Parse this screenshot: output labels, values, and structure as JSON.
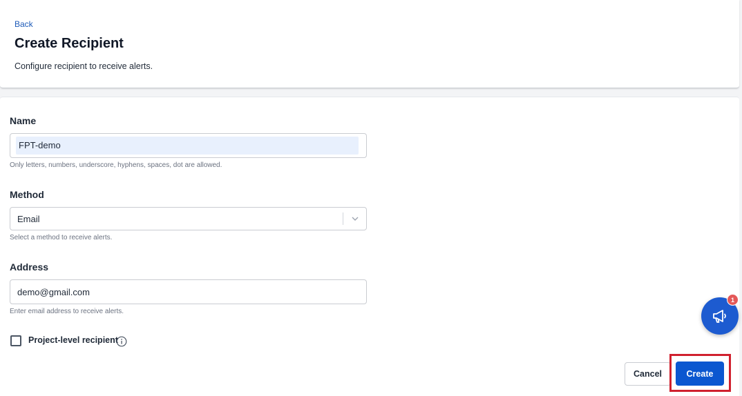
{
  "header": {
    "back_label": "Back",
    "title": "Create Recipient",
    "subtitle": "Configure recipient to receive alerts."
  },
  "form": {
    "name": {
      "label": "Name",
      "value": "FPT-demo",
      "help": "Only letters, numbers, underscore, hyphens, spaces, dot are allowed."
    },
    "method": {
      "label": "Method",
      "selected": "Email",
      "help": "Select a method to receive alerts."
    },
    "address": {
      "label": "Address",
      "value": "demo@gmail.com",
      "help": "Enter email address to receive alerts."
    },
    "project_level": {
      "label": "Project-level recipient",
      "checked": false
    }
  },
  "actions": {
    "cancel_label": "Cancel",
    "create_label": "Create"
  },
  "announcements": {
    "badge_count": "1"
  },
  "colors": {
    "primary": "#0b57d0",
    "link": "#1e5bb8",
    "highlight_frame": "#d0202e",
    "badge": "#e45858"
  }
}
